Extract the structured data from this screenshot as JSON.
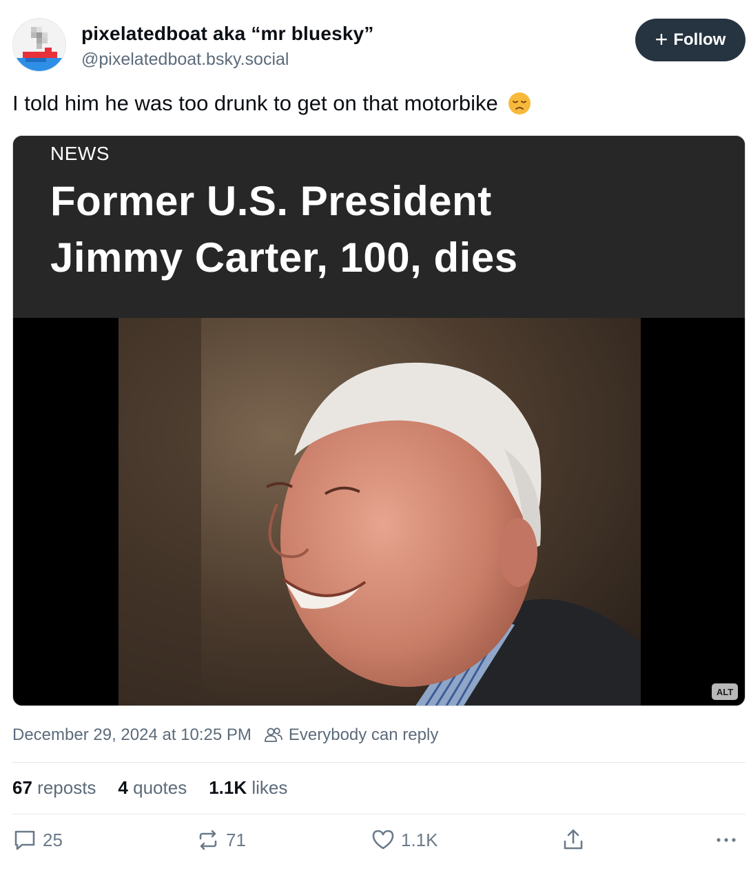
{
  "author": {
    "display_name": "pixelatedboat aka “mr bluesky”",
    "handle": "@pixelatedboat.bsky.social",
    "avatar_icon": "pixel-boat-avatar-icon"
  },
  "follow_button": {
    "label": "Follow",
    "icon": "plus-icon"
  },
  "post": {
    "text": "I told him he was too drunk to get on that motorbike",
    "emoji": "disappointed-face-emoji"
  },
  "media": {
    "news_label": "NEWS",
    "headline_line1": "Former U.S. President",
    "headline_line2": "Jimmy Carter, 100, dies",
    "alt_badge": "ALT"
  },
  "meta": {
    "timestamp": "December 29, 2024 at 10:25 PM",
    "reply_setting": "Everybody can reply"
  },
  "stats": {
    "reposts_count": "67",
    "reposts_label": "reposts",
    "quotes_count": "4",
    "quotes_label": "quotes",
    "likes_count": "1.1K",
    "likes_label": "likes"
  },
  "actions": {
    "reply_count": "25",
    "repost_count": "71",
    "like_count": "1.1K"
  },
  "colors": {
    "follow_bg": "#263340",
    "muted_text": "#5c6b7a",
    "banner_bg": "#272727"
  }
}
